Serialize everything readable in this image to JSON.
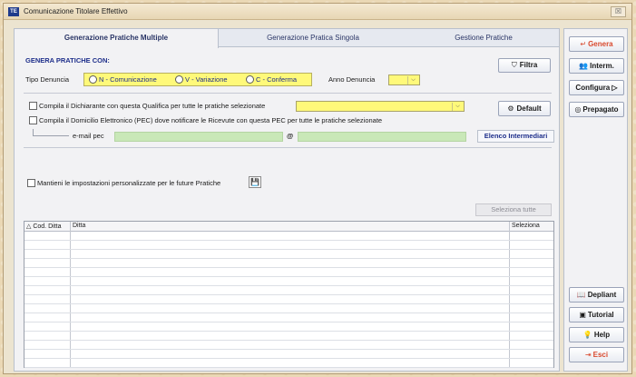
{
  "window": {
    "title": "Comunicazione Titolare Effettivo",
    "close_glyph": "☒"
  },
  "tabs": [
    {
      "label": "Generazione Pratiche Multiple"
    },
    {
      "label": "Generazione Pratica Singola"
    },
    {
      "label": "Gestione Pratiche"
    }
  ],
  "form": {
    "section_title": "GENERA PRATICHE CON:",
    "tipo_label": "Tipo Denuncia",
    "radios": [
      {
        "label": "N - Comunicazione"
      },
      {
        "label": "V - Variazione"
      },
      {
        "label": "C - Conferma"
      }
    ],
    "anno_label": "Anno Denuncia",
    "anno_value": "",
    "filtra_label": "Filtra",
    "qualifica_label": "Compila il Dichiarante con questa Qualifica per tutte le pratiche selezionate",
    "qualifica_value": "",
    "default_label": "Default",
    "pec_label": "Compila il Domicilio Elettronico (PEC) dove notificare le Ricevute con questa PEC per tutte le pratiche selezionate",
    "email_label": "e-mail pec",
    "email_user": "",
    "at_sign": "@",
    "email_domain": "",
    "elenco_label": "Elenco Intermediari",
    "mantieni_label": "Mantieni le impostazioni personalizzate per le future Pratiche",
    "seleziona_tutte": "Seleziona tutte"
  },
  "grid": {
    "sort_glyph": "△",
    "columns": [
      "Cod. Ditta",
      "Ditta",
      "Seleziona"
    ],
    "rows": []
  },
  "sidebar": {
    "genera": "Genera",
    "interm": "Interm.",
    "configura": "Configura ▷",
    "prepagato": "Prepagato",
    "depliant": "Depliant",
    "tutorial": "Tutorial",
    "help": "Help",
    "esci": "Esci"
  },
  "colors": {
    "accent": "#1d2e8a",
    "required_yellow": "#fff97a",
    "field_green": "#c9e8b8",
    "exit_red": "#d9492e"
  },
  "icons": {
    "filtra": "funnel-icon",
    "default": "gear-icon",
    "save": "floppy-disk-icon",
    "genera": "enter-arrow-icon",
    "interm": "people-icon",
    "prepagato": "coins-icon",
    "depliant": "book-icon",
    "tutorial": "monitor-icon",
    "help": "lightbulb-icon",
    "esci": "exit-icon"
  }
}
